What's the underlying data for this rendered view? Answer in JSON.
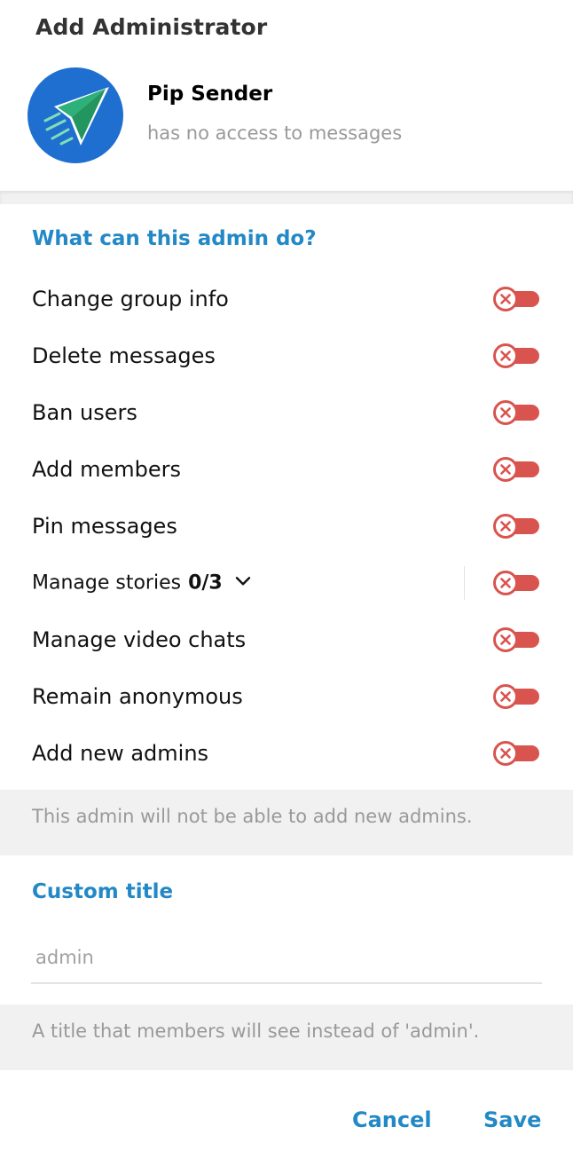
{
  "dialog": {
    "title": "Add Administrator"
  },
  "bot": {
    "name": "Pip Sender",
    "status": "has no access to messages",
    "avatar_color": "#1f6fd1",
    "avatar_icon": "paper-plane-icon"
  },
  "permissions": {
    "section_title": "What can this admin do?",
    "accent_color": "#2388c6",
    "toggle_off_color": "#d9544f",
    "items": [
      {
        "label": "Change group info",
        "enabled": false
      },
      {
        "label": "Delete messages",
        "enabled": false
      },
      {
        "label": "Ban users",
        "enabled": false
      },
      {
        "label": "Add members",
        "enabled": false
      },
      {
        "label": "Pin messages",
        "enabled": false
      },
      {
        "label": "Manage stories",
        "count": "0/3",
        "expandable": true,
        "enabled": false
      },
      {
        "label": "Manage video chats",
        "enabled": false
      },
      {
        "label": "Remain anonymous",
        "enabled": false
      },
      {
        "label": "Add new admins",
        "enabled": false
      }
    ],
    "note": "This admin will not be able to add new admins."
  },
  "custom_title": {
    "section_title": "Custom title",
    "placeholder": "admin",
    "value": "",
    "note": "A title that members will see instead of 'admin'."
  },
  "actions": {
    "cancel_label": "Cancel",
    "save_label": "Save"
  }
}
